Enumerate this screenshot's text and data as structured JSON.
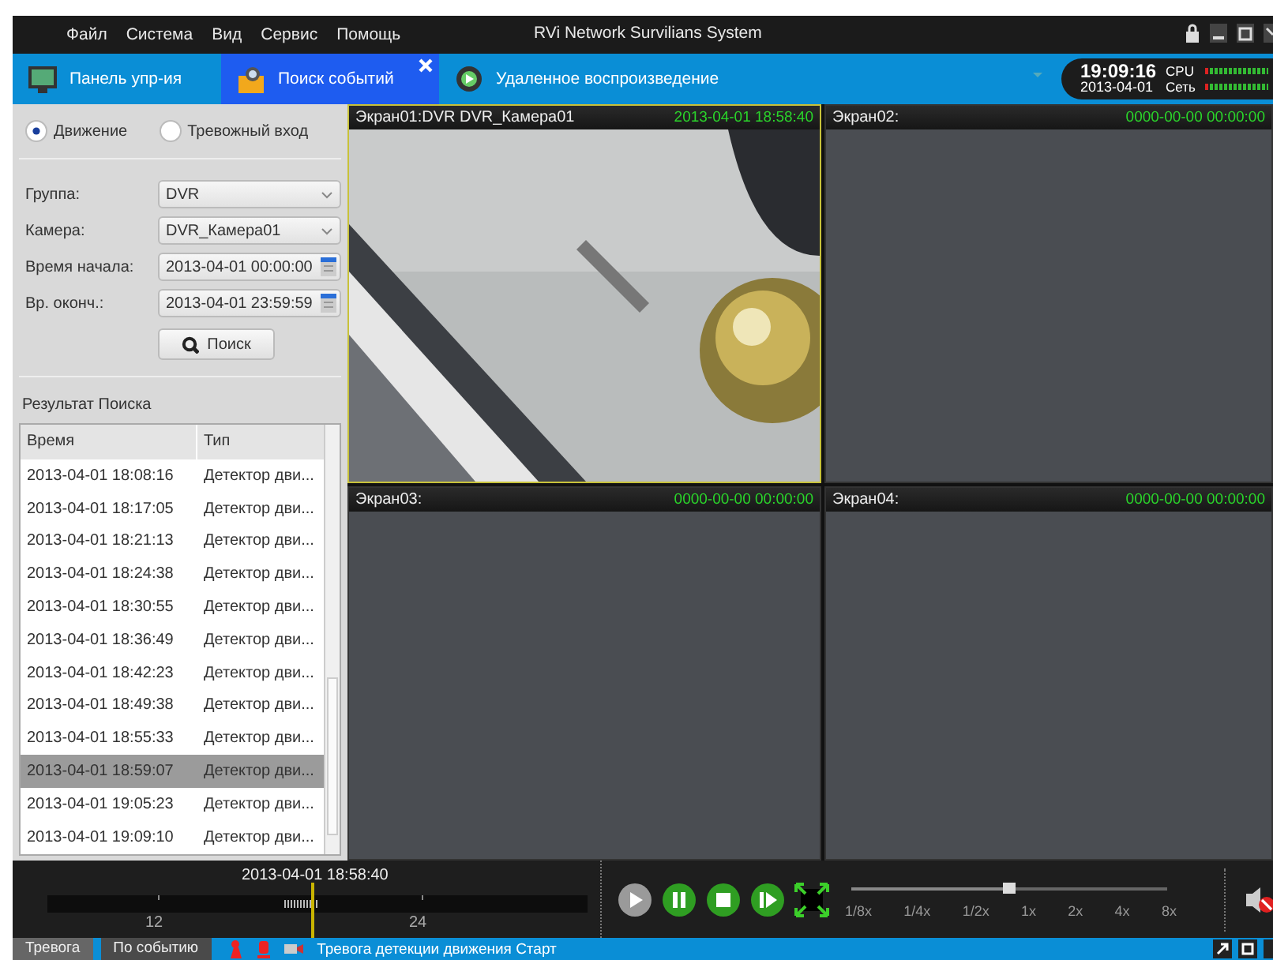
{
  "menu": [
    "Файл",
    "Система",
    "Вид",
    "Сервис",
    "Помощь"
  ],
  "window": {
    "title": "RVi Network Survilians System"
  },
  "tabs": [
    {
      "label": "Панель упр-ия",
      "kind": "panel",
      "selected": false
    },
    {
      "label": "Поиск событий",
      "kind": "search",
      "selected": true
    },
    {
      "label": "Удаленное воспроизведение",
      "kind": "remote",
      "selected": false
    }
  ],
  "clock": {
    "time": "19:09:16",
    "date": "2013-04-01"
  },
  "meters": [
    "CPU",
    "Сеть"
  ],
  "search": {
    "modes": [
      {
        "label": "Движение",
        "selected": true
      },
      {
        "label": "Тревожный вход",
        "selected": false
      }
    ],
    "fields": [
      {
        "kind": "select",
        "label": "Группа:",
        "value": "DVR"
      },
      {
        "kind": "select",
        "label": "Камера:",
        "value": "DVR_Камера01"
      },
      {
        "kind": "datetime",
        "label": "Время начала:",
        "value": "2013-04-01 00:00:00"
      },
      {
        "kind": "datetime",
        "label": "Вр. оконч.:",
        "value": "2013-04-01 23:59:59"
      }
    ],
    "button": "Поиск",
    "results_title": "Результат Поиска",
    "columns": [
      "Время",
      "Тип"
    ],
    "rows": [
      {
        "time": "2013-04-01 18:08:16",
        "type": "Детектор дви...",
        "selected": false
      },
      {
        "time": "2013-04-01 18:17:05",
        "type": "Детектор дви...",
        "selected": false
      },
      {
        "time": "2013-04-01 18:21:13",
        "type": "Детектор дви...",
        "selected": false
      },
      {
        "time": "2013-04-01 18:24:38",
        "type": "Детектор дви...",
        "selected": false
      },
      {
        "time": "2013-04-01 18:30:55",
        "type": "Детектор дви...",
        "selected": false
      },
      {
        "time": "2013-04-01 18:36:49",
        "type": "Детектор дви...",
        "selected": false
      },
      {
        "time": "2013-04-01 18:42:23",
        "type": "Детектор дви...",
        "selected": false
      },
      {
        "time": "2013-04-01 18:49:38",
        "type": "Детектор дви...",
        "selected": false
      },
      {
        "time": "2013-04-01 18:55:33",
        "type": "Детектор дви...",
        "selected": false
      },
      {
        "time": "2013-04-01 18:59:07",
        "type": "Детектор дви...",
        "selected": true
      },
      {
        "time": "2013-04-01 19:05:23",
        "type": "Детектор дви...",
        "selected": false
      },
      {
        "time": "2013-04-01 19:09:10",
        "type": "Детектор дви...",
        "selected": false
      }
    ]
  },
  "screens": [
    {
      "title": "Экран01:DVR DVR_Камера01",
      "timestamp": "2013-04-01 18:58:40",
      "kind": "video",
      "active": true
    },
    {
      "title": "Экран02:",
      "timestamp": "0000-00-00 00:00:00",
      "kind": "empty",
      "active": false
    },
    {
      "title": "Экран03:",
      "timestamp": "0000-00-00 00:00:00",
      "kind": "empty",
      "active": false
    },
    {
      "title": "Экран04:",
      "timestamp": "0000-00-00 00:00:00",
      "kind": "empty",
      "active": false
    }
  ],
  "playback": {
    "current_time": "2013-04-01 18:58:40",
    "ticks": [
      "12",
      "24"
    ],
    "speeds": [
      "1/8x",
      "1/4x",
      "1/2x",
      "1x",
      "2x",
      "4x",
      "8x"
    ],
    "level": 0.5
  },
  "status_bar": {
    "buttons": [
      {
        "label": "Тревога",
        "selected": false
      },
      {
        "label": "По событию",
        "selected": true
      }
    ],
    "message": "Тревога детекции движения Старт"
  }
}
